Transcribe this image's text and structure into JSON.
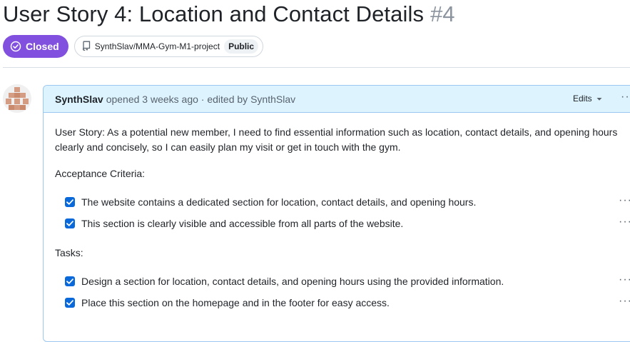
{
  "issue": {
    "title": "User Story 4: Location and Contact Details",
    "number": "#4",
    "state": "Closed",
    "state_icon": "check-circle-icon",
    "repo": "SynthSlav/MMA-Gym-M1-project",
    "repo_icon": "repo-icon",
    "visibility": "Public"
  },
  "comment": {
    "author": "SynthSlav",
    "action": "opened 3 weeks ago · edited by SynthSlav",
    "edits_label": "Edits",
    "more_label": "···",
    "body_paragraph": "User Story: As a potential new member, I need to find essential information such as location, contact details, and opening hours clearly and concisely, so I can easily plan my visit or get in touch with the gym.",
    "criteria_label": "Acceptance Criteria:",
    "criteria": [
      {
        "text": "The website contains a dedicated section for location, contact details, and opening hours.",
        "checked": true
      },
      {
        "text": "This section is clearly visible and accessible from all parts of the website.",
        "checked": true
      }
    ],
    "tasks_label": "Tasks:",
    "tasks": [
      {
        "text": "Design a section for location, contact details, and opening hours using the provided information.",
        "checked": true
      },
      {
        "text": "Place this section on the homepage and in the footer for easy access.",
        "checked": true
      }
    ]
  },
  "colors": {
    "closed_purple": "#8250df",
    "header_blue": "#ddf4ff",
    "checkbox_blue": "#0969da"
  }
}
